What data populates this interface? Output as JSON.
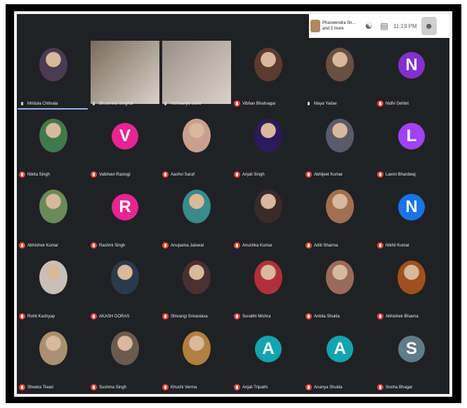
{
  "topbar": {
    "presenter_line1": "Phaswendra Sn...",
    "presenter_line2": "and 3 more",
    "people_icon": "people-icon",
    "chat_icon": "chat-icon",
    "time": "11:19 PM",
    "user_icon": "user-icon"
  },
  "participants": [
    {
      "name": "Mridula Chitnala",
      "muted": false,
      "kind": "photo",
      "color": "#4a3a52",
      "active": true
    },
    {
      "name": "Bhoomika Singhal",
      "muted": false,
      "kind": "video",
      "color": "#7a6b5c"
    },
    {
      "name": "Aishwarya Sahu",
      "muted": false,
      "kind": "video",
      "color": "#9a8f86"
    },
    {
      "name": "Vibhav Bhatnagar",
      "muted": true,
      "kind": "photo",
      "color": "#5b3b2b"
    },
    {
      "name": "Maya Yadav",
      "muted": false,
      "kind": "photo",
      "color": "#6a5040"
    },
    {
      "name": "Nidhi Gehlot",
      "muted": true,
      "kind": "letter",
      "letter": "N",
      "color": "#8430ce"
    },
    {
      "name": "Nikita Singh",
      "muted": true,
      "kind": "photo",
      "color": "#3f7a4a"
    },
    {
      "name": "Vaibhavi Rastogi",
      "muted": true,
      "kind": "letter",
      "letter": "V",
      "color": "#e52592"
    },
    {
      "name": "Aashvi Saraf",
      "muted": true,
      "kind": "photo",
      "color": "#c9a090"
    },
    {
      "name": "Anjali Singh",
      "muted": true,
      "kind": "photo",
      "color": "#2a1a5a"
    },
    {
      "name": "Abhijeet Kumar",
      "muted": true,
      "kind": "photo",
      "color": "#5a5a6a"
    },
    {
      "name": "Laxmi Bhardwaj",
      "muted": true,
      "kind": "letter",
      "letter": "L",
      "color": "#a142f4"
    },
    {
      "name": "Abhishek Kumar",
      "muted": true,
      "kind": "photo",
      "color": "#6a8a5a"
    },
    {
      "name": "Rashmi Singh",
      "muted": true,
      "kind": "letter",
      "letter": "R",
      "color": "#e52592"
    },
    {
      "name": "Anupama Jaiswal",
      "muted": true,
      "kind": "photo",
      "color": "#3a8a8a"
    },
    {
      "name": "Anushka Kumar",
      "muted": true,
      "kind": "photo",
      "color": "#3a2a2a"
    },
    {
      "name": "Aditi Sharma",
      "muted": true,
      "kind": "photo",
      "color": "#a07050"
    },
    {
      "name": "Nikhil Kumar",
      "muted": true,
      "kind": "letter",
      "letter": "N",
      "color": "#1a73e8"
    },
    {
      "name": "Rohit Kashyap",
      "muted": true,
      "kind": "photo",
      "color": "#c8c0b8"
    },
    {
      "name": "AKASH DORAS",
      "muted": true,
      "kind": "photo",
      "color": "#2a3a4a"
    },
    {
      "name": "Shivangi Srivastava",
      "muted": true,
      "kind": "photo",
      "color": "#4a3030"
    },
    {
      "name": "Surabhi Mishra",
      "muted": true,
      "kind": "photo",
      "color": "#b0303a"
    },
    {
      "name": "Ankita Shukla",
      "muted": true,
      "kind": "photo",
      "color": "#9a6a5a"
    },
    {
      "name": "Abhishek Bhavna",
      "muted": true,
      "kind": "photo",
      "color": "#a05020"
    },
    {
      "name": "Shweta Tiwari",
      "muted": true,
      "kind": "photo",
      "color": "#a89070"
    },
    {
      "name": "Sushma Singh",
      "muted": true,
      "kind": "photo",
      "color": "#6a5a50"
    },
    {
      "name": "Khushi Verma",
      "muted": true,
      "kind": "photo",
      "color": "#b08040"
    },
    {
      "name": "Anjali Tripathi",
      "muted": true,
      "kind": "letter",
      "letter": "A",
      "color": "#12a4af"
    },
    {
      "name": "Ananya Shukla",
      "muted": true,
      "kind": "letter",
      "letter": "A",
      "color": "#12a4af"
    },
    {
      "name": "Sneha Bhagat",
      "muted": true,
      "kind": "letter",
      "letter": "S",
      "color": "#5f7c8a"
    }
  ]
}
